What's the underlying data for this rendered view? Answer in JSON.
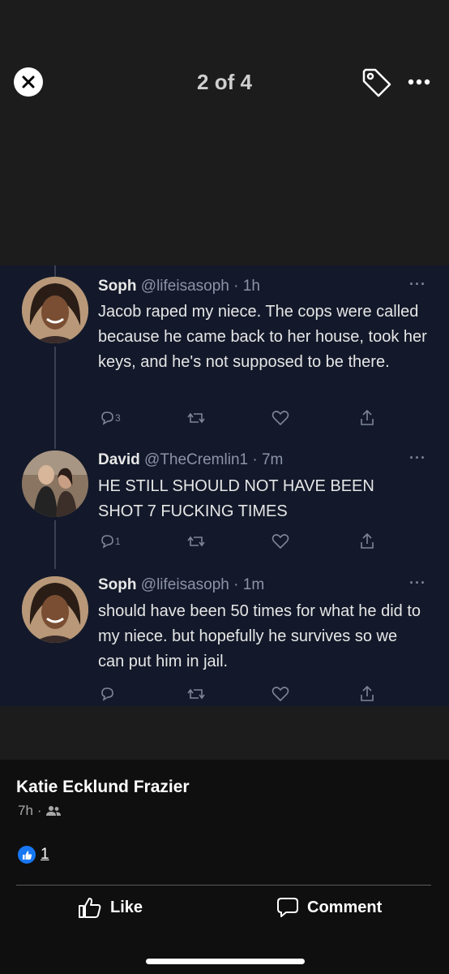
{
  "viewer": {
    "counter": "2 of 4",
    "close_icon": "close-icon",
    "tag_icon": "tag-icon",
    "more_icon": "more-horizontal-icon"
  },
  "tweets": [
    {
      "name": "Soph",
      "handle": "@lifeisasoph",
      "time": "· 1h",
      "text": "Jacob raped my niece. The cops were called because he came back to her house, took her keys, and he's not supposed to be there.",
      "reply_count": "3"
    },
    {
      "name": "David",
      "handle": "@TheCremlin1",
      "time": "· 7m",
      "text": "HE STILL SHOULD NOT HAVE BEEN SHOT 7 FUCKING TIMES",
      "reply_count": "1"
    },
    {
      "name": "Soph",
      "handle": "@lifeisasoph",
      "time": "· 1m",
      "text": "should have been 50 times for what he did to my niece. but hopefully he survives so we can put him in jail.",
      "reply_count": ""
    }
  ],
  "tweet_more": "···",
  "post": {
    "author": "Katie Ecklund Frazier",
    "time": "7h",
    "separator": "·",
    "audience_icon": "friends-icon",
    "reaction_count": "1",
    "like_label": "Like",
    "comment_label": "Comment"
  },
  "colors": {
    "viewer_bg": "#1c1c1c",
    "tweet_bg": "#13192a",
    "post_bg": "#0f0f0f",
    "facebook_blue": "#1877f2"
  }
}
